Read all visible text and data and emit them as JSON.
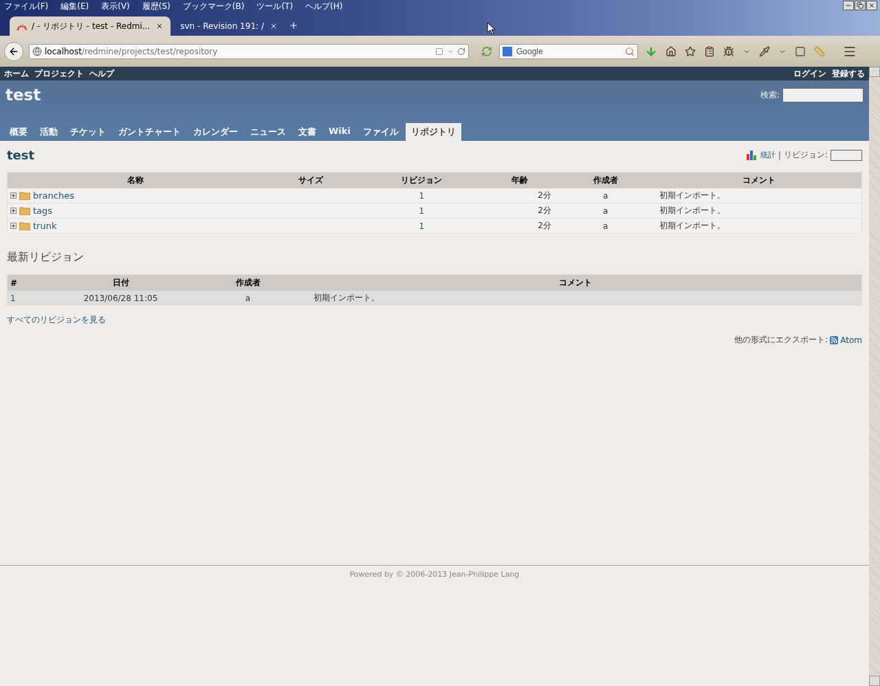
{
  "browser": {
    "menu": [
      "ファイル(F)",
      "編集(E)",
      "表示(V)",
      "履歴(S)",
      "ブックマーク(B)",
      "ツール(T)",
      "ヘルプ(H)"
    ],
    "tabs": [
      {
        "title": "/ - リポジトリ - test - Redmi...",
        "selected": true
      },
      {
        "title": "svn - Revision 191: /",
        "selected": false
      }
    ],
    "address": {
      "host": "localhost",
      "path": "/redmine/projects/test/repository"
    },
    "search": {
      "placeholder": "Google"
    }
  },
  "top_menu": {
    "left": [
      "ホーム",
      "プロジェクト",
      "ヘルプ"
    ],
    "right": [
      "ログイン",
      "登録する"
    ]
  },
  "header": {
    "title": "test",
    "search_label": "検索:"
  },
  "main_tabs": [
    {
      "label": "概要",
      "selected": false
    },
    {
      "label": "活動",
      "selected": false
    },
    {
      "label": "チケット",
      "selected": false
    },
    {
      "label": "ガントチャート",
      "selected": false
    },
    {
      "label": "カレンダー",
      "selected": false
    },
    {
      "label": "ニュース",
      "selected": false
    },
    {
      "label": "文書",
      "selected": false
    },
    {
      "label": "Wiki",
      "selected": false
    },
    {
      "label": "ファイル",
      "selected": false
    },
    {
      "label": "リポジトリ",
      "selected": true
    }
  ],
  "content": {
    "title": "test",
    "stats_link": "統計",
    "separator": "|",
    "revision_label": "リビジョン:",
    "files": {
      "columns": [
        "名称",
        "サイズ",
        "リビジョン",
        "年齢",
        "作成者",
        "コメント"
      ],
      "rows": [
        {
          "name": "branches",
          "revision": "1",
          "age": "2分",
          "author": "a",
          "comment": "初期インポート。"
        },
        {
          "name": "tags",
          "revision": "1",
          "age": "2分",
          "author": "a",
          "comment": "初期インポート。"
        },
        {
          "name": "trunk",
          "revision": "1",
          "age": "2分",
          "author": "a",
          "comment": "初期インポート。"
        }
      ]
    },
    "latest_heading": "最新リビジョン",
    "revisions": {
      "columns": [
        "#",
        "日付",
        "作成者",
        "コメント"
      ],
      "rows": [
        {
          "id": "1",
          "date": "2013/06/28 11:05",
          "author": "a",
          "comment": "初期インポート。"
        }
      ]
    },
    "all_revisions_link": "すべてのリビジョンを見る",
    "export_label": "他の形式にエクスポート:",
    "export_link": "Atom"
  },
  "footer": "Powered by © 2006-2013 Jean-Philippe Lang"
}
